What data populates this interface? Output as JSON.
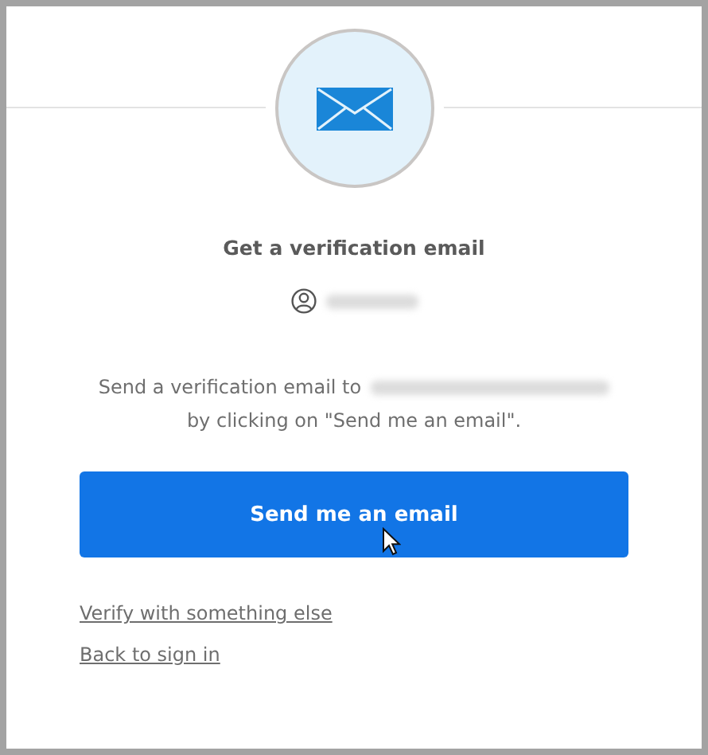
{
  "title": "Get a verification email",
  "message": {
    "before_email": "Send a verification email to",
    "after_email": "by clicking on \"Send me an email\"."
  },
  "primary_button": "Send me an email",
  "links": [
    "Verify with something else",
    "Back to sign in"
  ]
}
